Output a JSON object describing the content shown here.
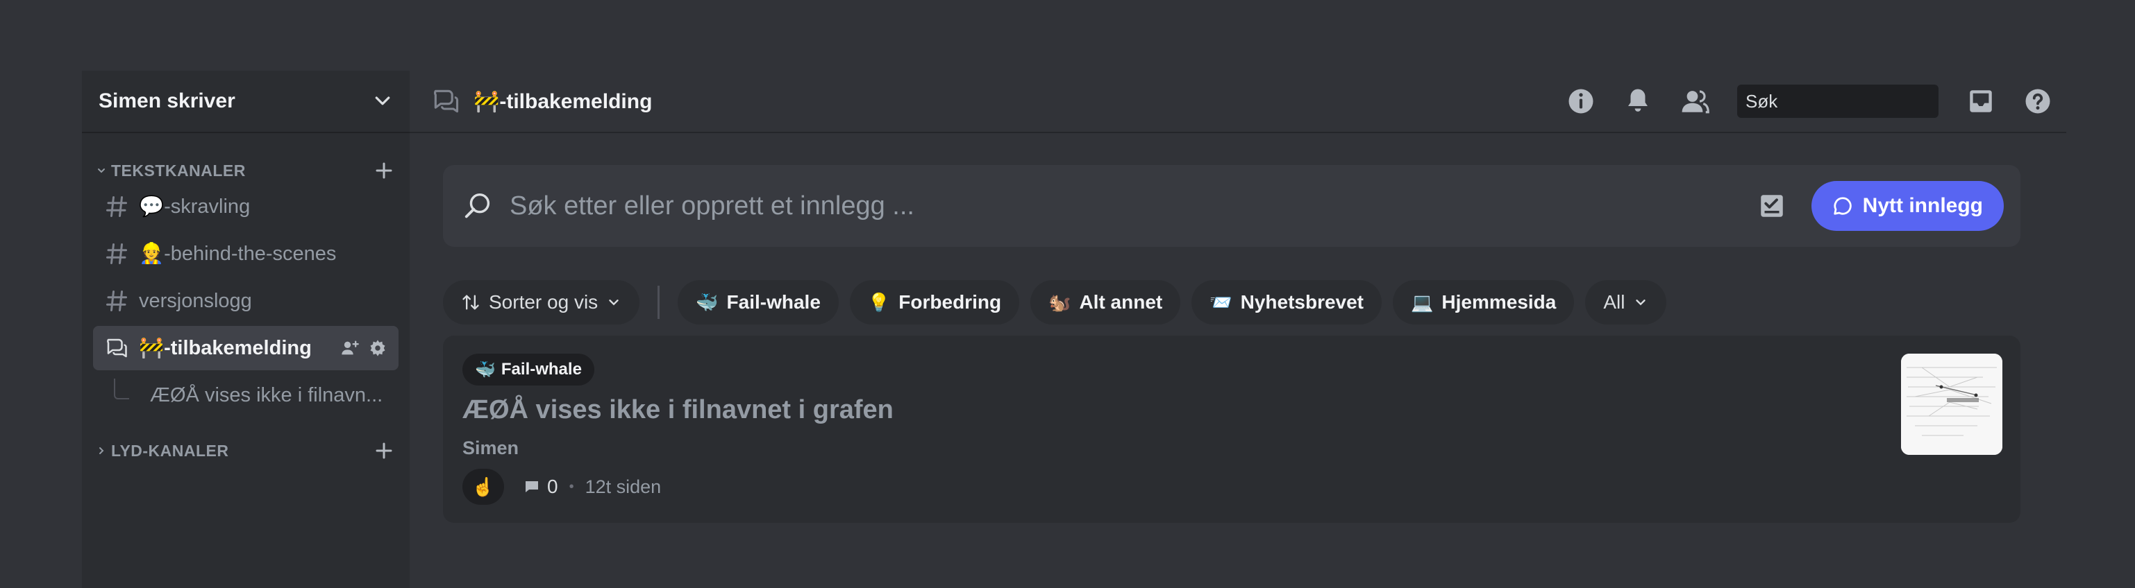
{
  "server": {
    "name": "Simen skriver"
  },
  "categories": {
    "text": {
      "name": "TEKSTKANALER"
    },
    "voice": {
      "name": "LYD-KANALER"
    }
  },
  "channels": [
    {
      "label": "💬-skravling"
    },
    {
      "label": "👷-behind-the-scenes"
    },
    {
      "label": "versjonslogg"
    },
    {
      "label": "🚧-tilbakemelding"
    }
  ],
  "thread": {
    "label": "ÆØÅ vises ikke i filnavn..."
  },
  "topbar": {
    "title": "🚧-tilbakemelding",
    "search_placeholder": "Søk"
  },
  "forum": {
    "search_placeholder": "Søk etter eller opprett et innlegg ...",
    "new_post_label": "Nytt innlegg",
    "sort_label": "Sorter og vis",
    "tags": [
      {
        "emoji": "🐳",
        "label": "Fail-whale"
      },
      {
        "emoji": "💡",
        "label": "Forbedring"
      },
      {
        "emoji": "🐿️",
        "label": "Alt annet"
      },
      {
        "emoji": "📨",
        "label": "Nyhetsbrevet"
      },
      {
        "emoji": "💻",
        "label": "Hjemmesida"
      }
    ],
    "all_label": "All"
  },
  "post": {
    "tag_emoji": "🐳",
    "tag_label": "Fail-whale",
    "title": "ÆØÅ vises ikke i filnavnet i grafen",
    "author": "Simen",
    "reaction": "☝️",
    "reply_count": "0",
    "timestamp": "12t siden"
  },
  "colors": {
    "accent": "#5865f2",
    "sidebar_bg": "#2b2d31",
    "main_bg": "#313338",
    "active_channel_bg": "#404249"
  }
}
